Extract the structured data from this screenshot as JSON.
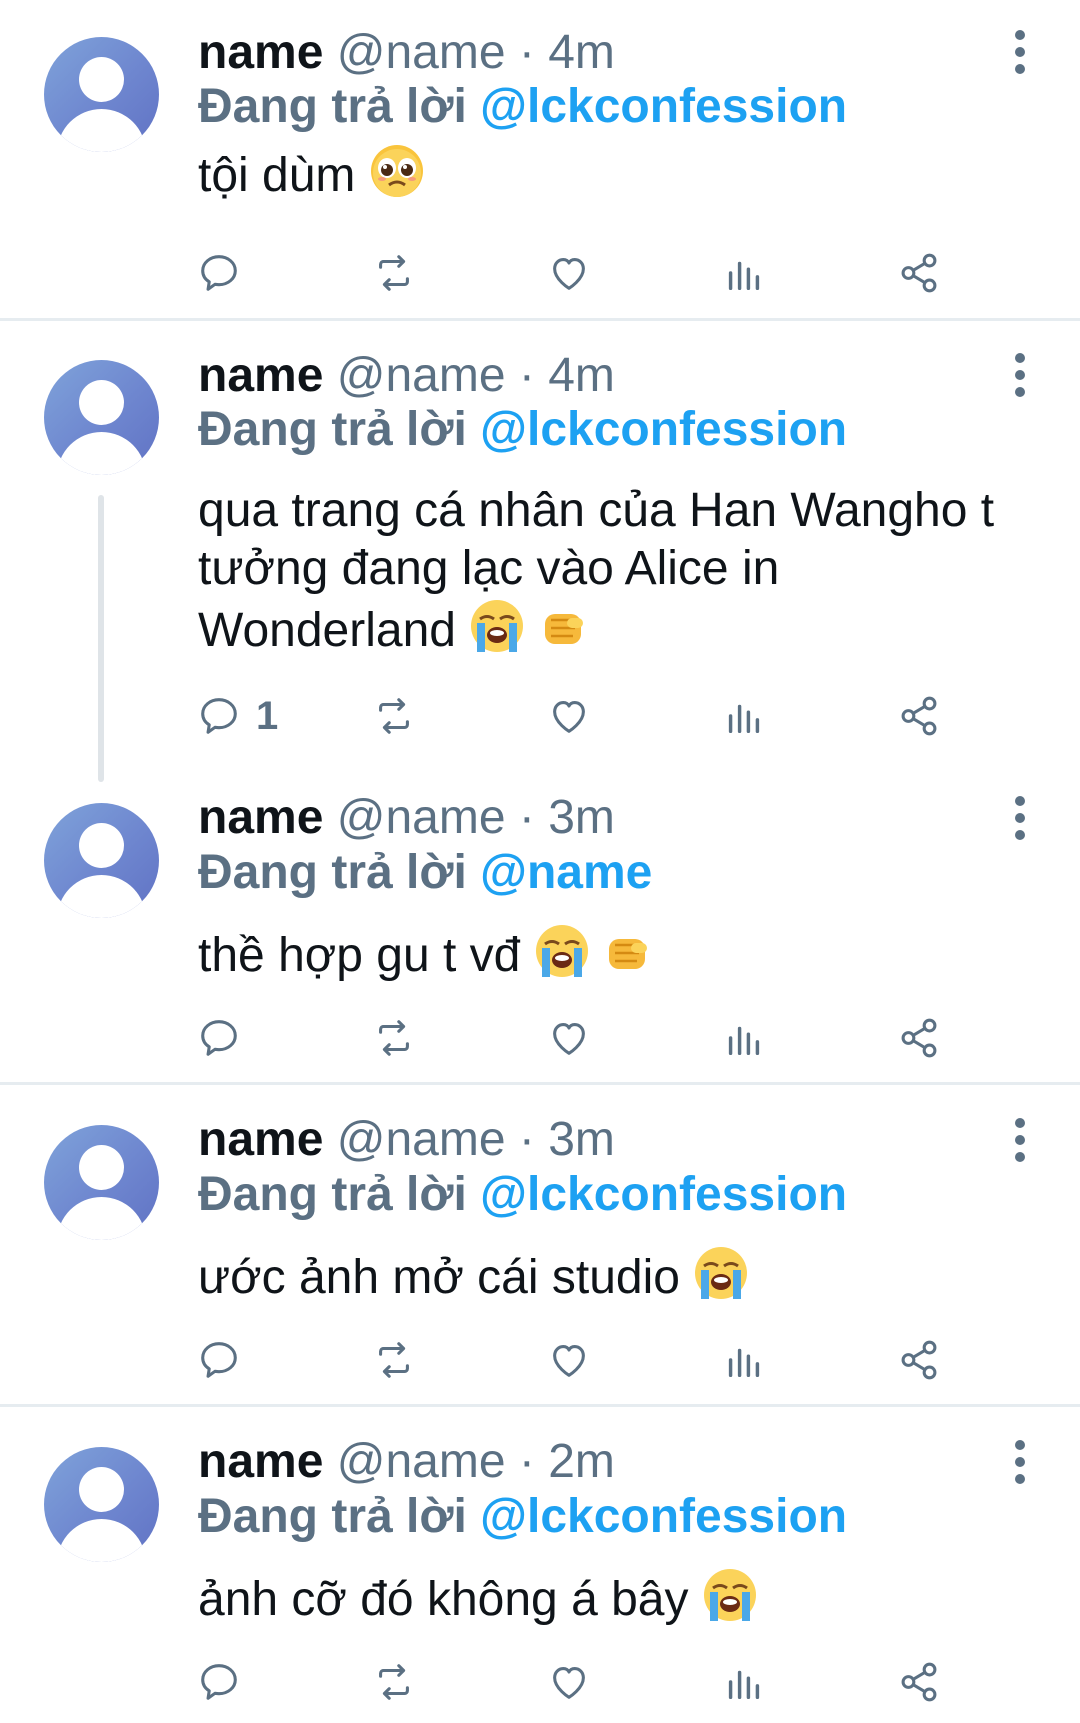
{
  "colors": {
    "link": "#1da1f2",
    "muted": "#5b7083",
    "text": "#0f1419"
  },
  "tweets": [
    {
      "name": "name",
      "handle": "@name",
      "separator": "·",
      "time": "4m",
      "reply_prefix": "Đang trả lời",
      "reply_to": "@lckconfession",
      "text": "tội dùm",
      "emojis": [
        "pleading-face"
      ],
      "reply_count": ""
    },
    {
      "name": "name",
      "handle": "@name",
      "separator": "·",
      "time": "4m",
      "reply_prefix": "Đang trả lời",
      "reply_to": "@lckconfession",
      "text": "qua trang cá nhân của Han Wangho t tưởng đang lạc vào Alice in Wonderland",
      "emojis": [
        "loudly-crying-face",
        "oncoming-fist"
      ],
      "reply_count": "1"
    },
    {
      "name": "name",
      "handle": "@name",
      "separator": "·",
      "time": "3m",
      "reply_prefix": "Đang trả lời",
      "reply_to": "@name",
      "text": "thề hợp gu t vđ",
      "emojis": [
        "loudly-crying-face",
        "oncoming-fist"
      ],
      "reply_count": ""
    },
    {
      "name": "name",
      "handle": "@name",
      "separator": "·",
      "time": "3m",
      "reply_prefix": "Đang trả lời",
      "reply_to": "@lckconfession",
      "text": "ước ảnh mở cái studio",
      "emojis": [
        "loudly-crying-face"
      ],
      "reply_count": ""
    },
    {
      "name": "name",
      "handle": "@name",
      "separator": "·",
      "time": "2m",
      "reply_prefix": "Đang trả lời",
      "reply_to": "@lckconfession",
      "text": "ảnh cỡ đó không á bây",
      "emojis": [
        "loudly-crying-face"
      ],
      "reply_count": ""
    }
  ]
}
